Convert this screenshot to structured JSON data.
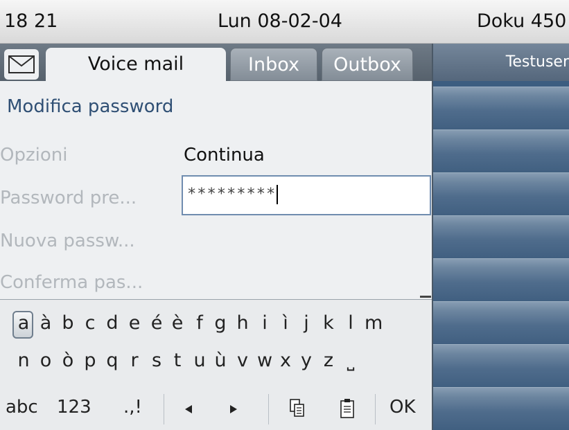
{
  "status_bar": {
    "time": "18 21",
    "date": "Lun 08-02-04",
    "device": "Doku 450"
  },
  "tabs": {
    "mail_icon": "envelope-icon",
    "voice_mail": "Voice mail",
    "inbox": "Inbox",
    "outbox": "Outbox"
  },
  "form": {
    "title": "Modifica password",
    "options_label": "Opzioni",
    "options_value": "Continua",
    "old_password_label": "Password pre...",
    "old_password_value": "*********",
    "new_password_label": "Nuova passw...",
    "confirm_password_label": "Conferma pas..."
  },
  "keyboard": {
    "row1": [
      "a",
      "à",
      "b",
      "c",
      "d",
      "e",
      "é",
      "è",
      "f",
      "g",
      "h",
      "i",
      "ì",
      "j",
      "k",
      "l",
      "m"
    ],
    "row2": [
      "n",
      "o",
      "ò",
      "p",
      "q",
      "r",
      "s",
      "t",
      "u",
      "ù",
      "v",
      "w",
      "x",
      "y",
      "z",
      "⎵"
    ],
    "selected_key": "a",
    "mode_abc": "abc",
    "mode_123": "123",
    "mode_punct": ".,!",
    "left_arrow_icon": "left-arrow-icon",
    "right_arrow_icon": "right-arrow-icon",
    "copy_icon": "copy-icon",
    "paste_icon": "paste-icon",
    "ok": "OK"
  },
  "right_panel": {
    "user": "Testuser"
  },
  "colors": {
    "accent_blue": "#2f4f74",
    "tabbar": "#5f6a75",
    "right_panel": "#3c5d80"
  }
}
